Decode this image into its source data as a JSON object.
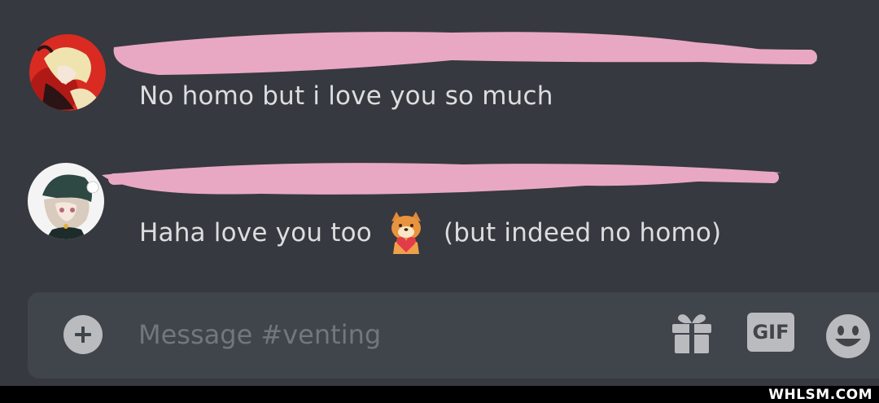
{
  "messages": [
    {
      "author_redacted": true,
      "text": "No homo but i love you so much",
      "avatar": "anime-avatar-blonde-red-bg"
    },
    {
      "author_redacted": true,
      "text_before": "Haha love you too",
      "emoji": "dog-holding-heart-emoji",
      "text_after": "(but indeed no homo)",
      "avatar": "anime-avatar-silver-hair-beanie"
    }
  ],
  "composer": {
    "placeholder": "Message #venting",
    "gif_label": "GIF",
    "icons": [
      "plus-circle-icon",
      "gift-icon",
      "gif-icon",
      "emoji-smile-icon"
    ]
  },
  "watermark": "WHLSM.COM",
  "colors": {
    "background": "#36393f",
    "input": "#40444b",
    "text": "#dcddde",
    "placeholder": "#72767d",
    "icon": "#b9bbbe",
    "redaction": "#e8a8c4"
  }
}
